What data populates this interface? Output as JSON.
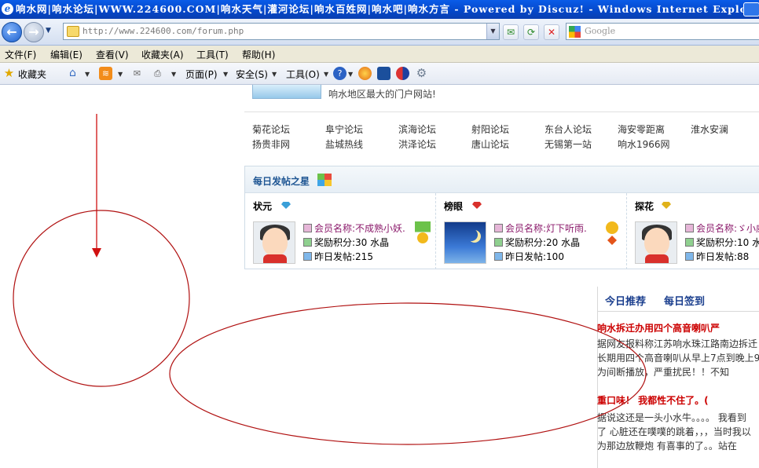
{
  "window": {
    "title": "响水网|响水论坛|WWW.224600.COM|响水天气|灌河论坛|响水百姓网|响水吧|响水方言 - Powered by Discuz! - Windows Internet Explorer"
  },
  "addressbar": {
    "url": "http://www.224600.com/forum.php",
    "search_placeholder": "Google"
  },
  "menu": [
    "文件(F)",
    "编辑(E)",
    "查看(V)",
    "收藏夹(A)",
    "工具(T)",
    "帮助(H)"
  ],
  "favbar": {
    "favorites": "收藏夹",
    "page": "页面(P)",
    "safety": "安全(S)",
    "tools": "工具(O)"
  },
  "portal": {
    "banner_text": "响水地区最大的门户网站!"
  },
  "links": [
    [
      "菊花论坛",
      "阜宁论坛",
      "滨海论坛",
      "射阳论坛",
      "东台人论坛",
      "海安零距离",
      "淮水安澜"
    ],
    [
      "扬贵非网",
      "盐城热线",
      "洪泽论坛",
      "唐山论坛",
      "无锡第一站",
      "响水1966网"
    ]
  ],
  "stars": {
    "title": "每日发帖之星",
    "ranks": [
      {
        "label": "状元",
        "name": "会员名称:不成熟小妖.",
        "points": "奖励积分:30 水晶",
        "posts": "昨日发帖:215",
        "gem": "#3a9fd8"
      },
      {
        "label": "榜眼",
        "name": "会员名称:灯下听雨.",
        "points": "奖励积分:20 水晶",
        "posts": "昨日发帖:100",
        "gem": "#d9302b"
      },
      {
        "label": "探花",
        "name": "会员名称:ゞ小威",
        "points": "奖励积分:10 水",
        "posts": "昨日发帖:88",
        "gem": "#e0b21a"
      }
    ]
  },
  "today": {
    "tab1": "今日推荐",
    "tab2": "每日签到",
    "news": [
      {
        "title": "响水拆迁办用四个高音喇叭严",
        "lines": [
          "据网友报料称江苏响水珠江路南边拆迁",
          "长期用四个高音喇叭从早上7点到晚上9",
          "为间断播放，严重扰民！！不知"
        ]
      },
      {
        "title": "重口味！  我都性不住了。(",
        "lines": [
          "据说这还是一头小水牛。。。。 我看到",
          "了 心脏还在噗噗的跳着，，，当时我以",
          "为那边放鞭炮 有喜事的了。。站在"
        ]
      }
    ]
  }
}
